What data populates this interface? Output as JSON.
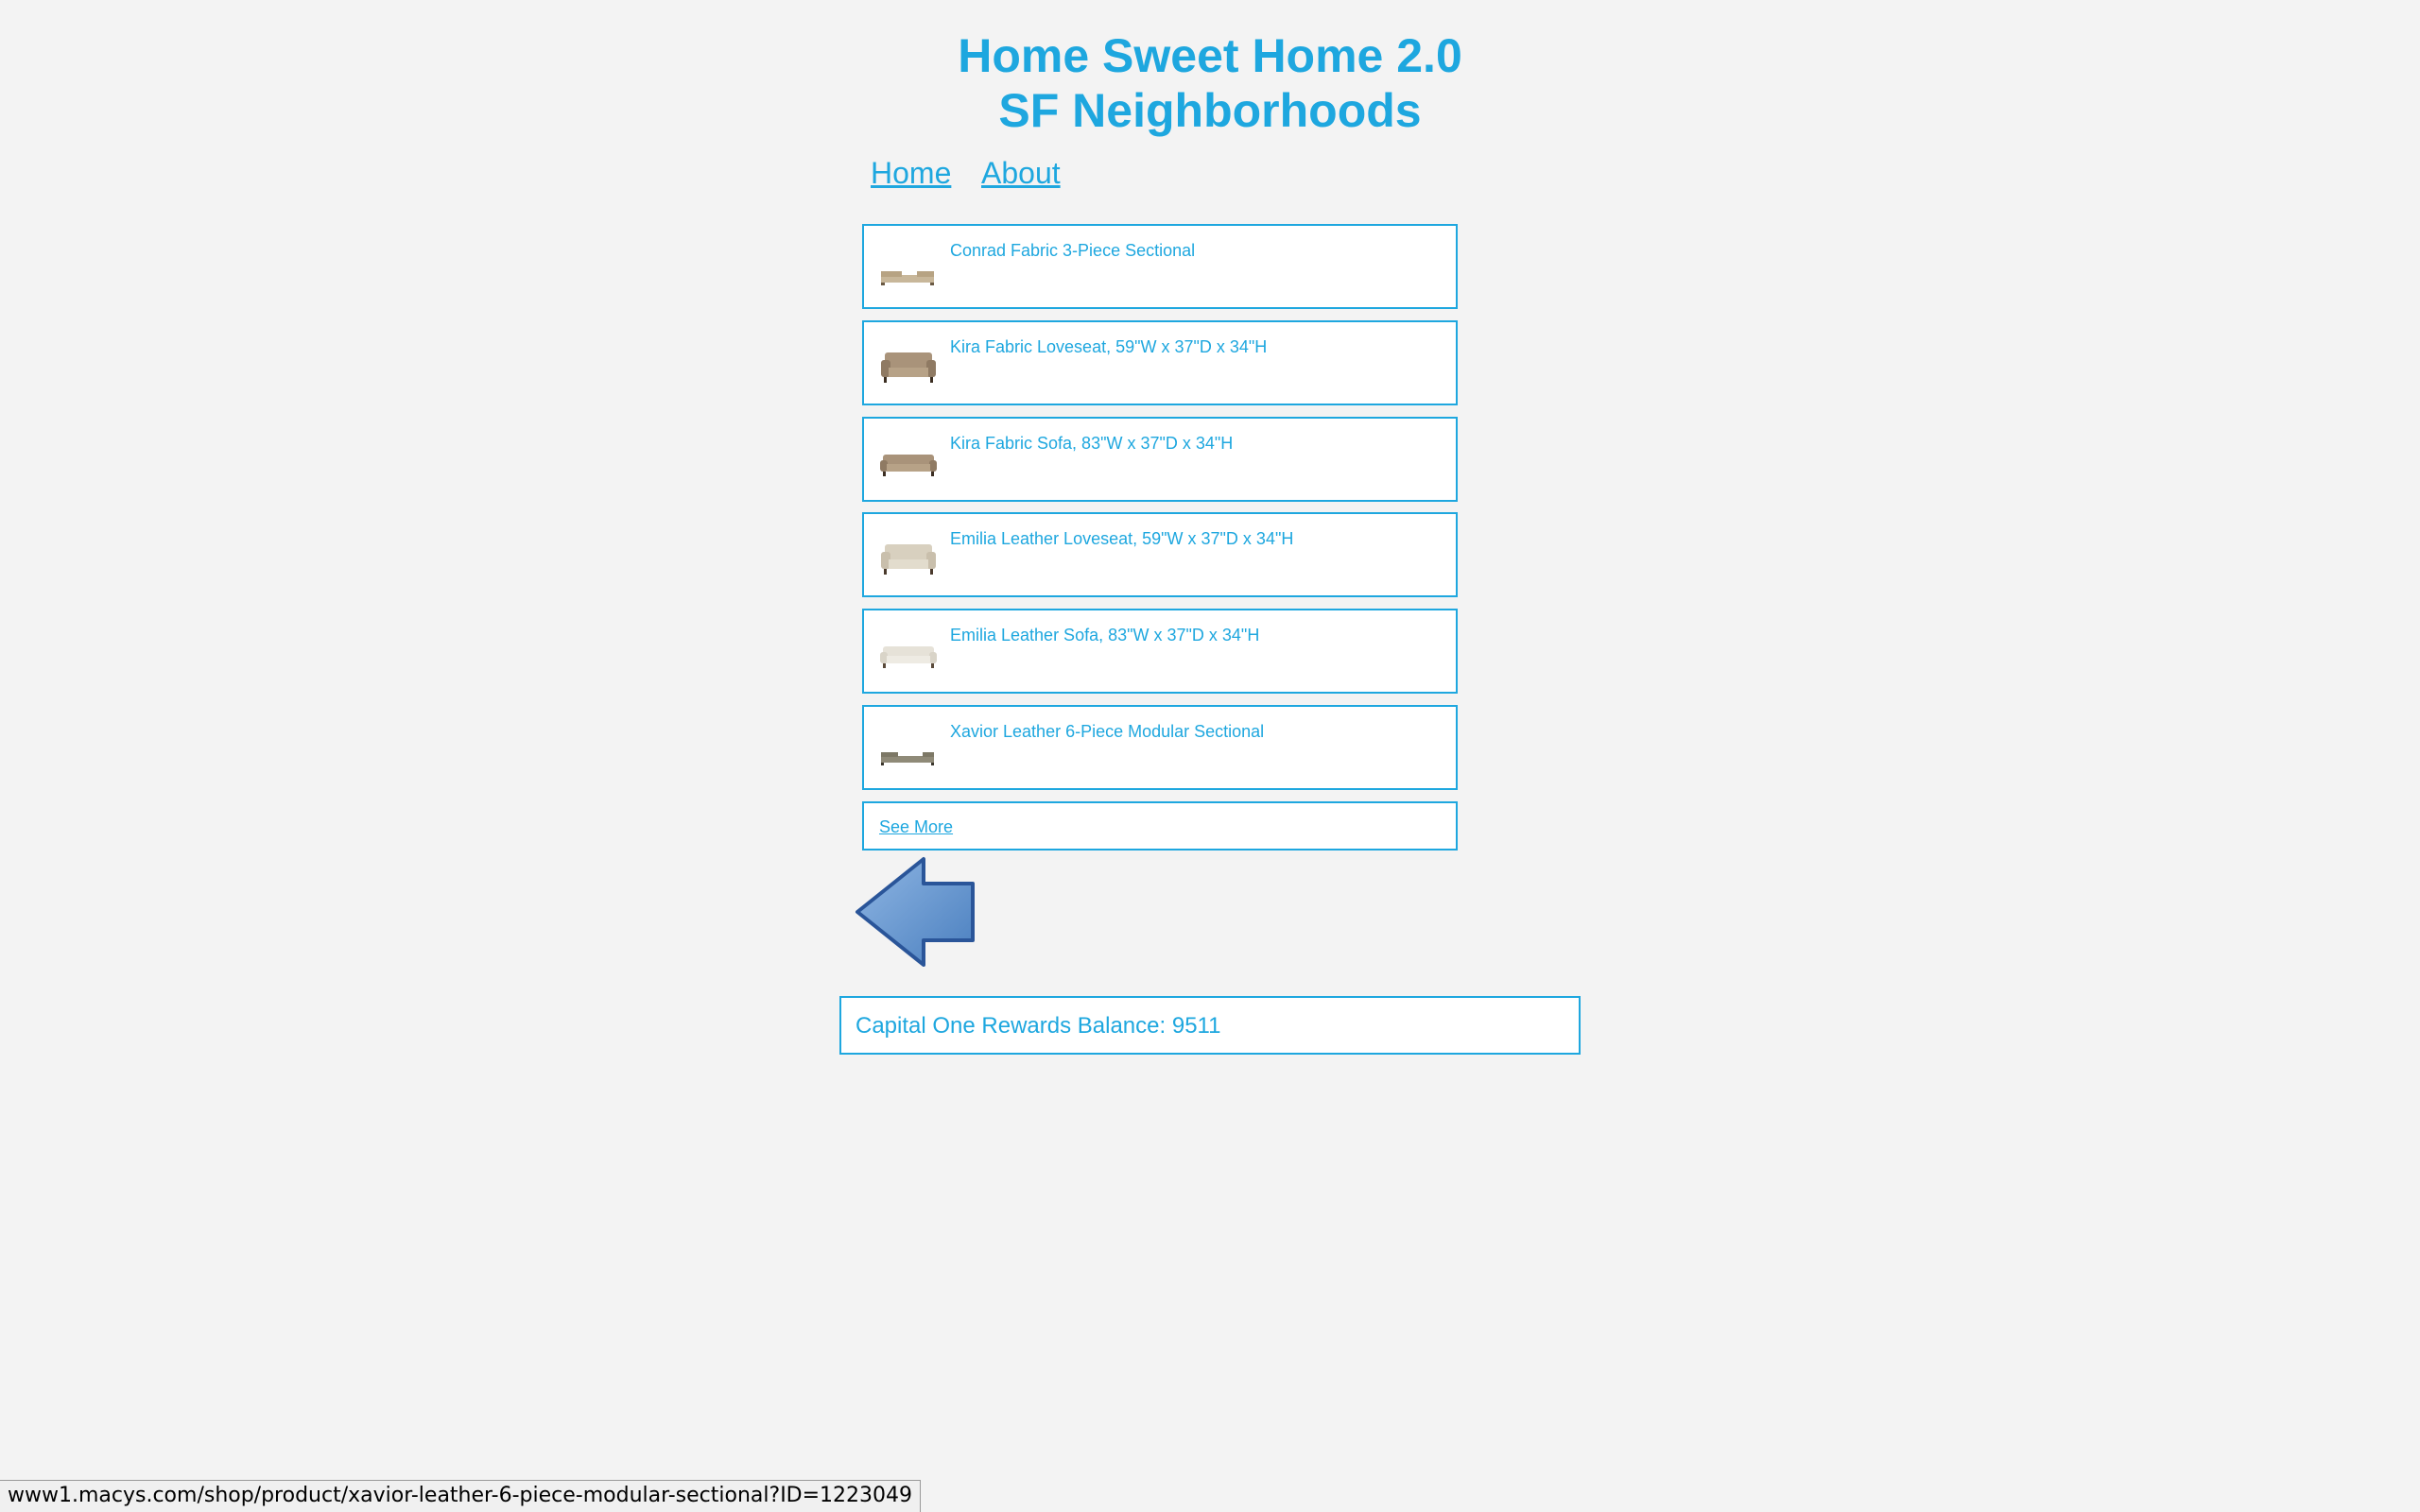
{
  "header": {
    "title_line1": "Home Sweet Home 2.0",
    "title_line2": "SF Neighborhoods"
  },
  "nav": {
    "home": "Home",
    "about": "About"
  },
  "products": [
    {
      "name": "Conrad Fabric 3-Piece Sectional",
      "thumb": "sectional-sofa-icon"
    },
    {
      "name": "Kira Fabric Loveseat, 59\"W x 37\"D x 34\"H",
      "thumb": "loveseat-icon"
    },
    {
      "name": "Kira Fabric Sofa, 83\"W x 37\"D x 34\"H",
      "thumb": "sofa-icon"
    },
    {
      "name": "Emilia Leather Loveseat, 59\"W x 37\"D x 34\"H",
      "thumb": "loveseat-icon"
    },
    {
      "name": "Emilia Leather Sofa, 83\"W x 37\"D x 34\"H",
      "thumb": "sofa-icon"
    },
    {
      "name": "Xavior Leather 6-Piece Modular Sectional",
      "thumb": "sectional-sofa-icon"
    }
  ],
  "see_more": "See More",
  "rewards": {
    "label": "Capital One Rewards Balance: 9511"
  },
  "status_bar": {
    "url": "www1.macys.com/shop/product/xavior-leather-6-piece-modular-sectional?ID=1223049"
  },
  "colors": {
    "accent": "#1ea7df",
    "background": "#f3f3f3",
    "arrow_fill": "#5b8fc8",
    "arrow_stroke": "#2a5599"
  },
  "icons": {
    "back": "arrow-left-icon"
  }
}
